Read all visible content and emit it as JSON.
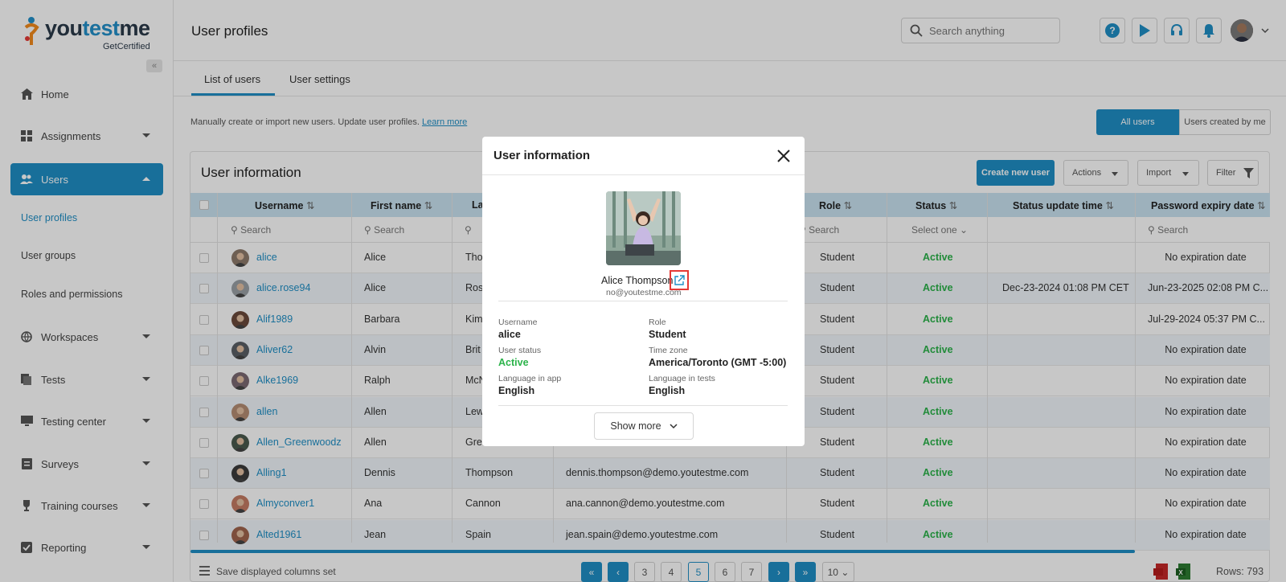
{
  "app": {
    "logo_text_a": "you",
    "logo_text_b": "test",
    "logo_text_c": "me",
    "logo_sub": "GetCertified"
  },
  "sidebar": {
    "items": [
      {
        "label": "Home",
        "icon": "home-icon"
      },
      {
        "label": "Assignments",
        "icon": "assignments-icon"
      },
      {
        "label": "Users",
        "icon": "users-icon"
      },
      {
        "label": "Workspaces",
        "icon": "globe-icon"
      },
      {
        "label": "Tests",
        "icon": "tests-icon"
      },
      {
        "label": "Testing center",
        "icon": "monitor-icon"
      },
      {
        "label": "Surveys",
        "icon": "surveys-icon"
      },
      {
        "label": "Training courses",
        "icon": "trophy-icon"
      },
      {
        "label": "Reporting",
        "icon": "reporting-icon"
      }
    ],
    "sub_items": [
      "User profiles",
      "User groups",
      "Roles and permissions"
    ]
  },
  "header": {
    "title": "User profiles",
    "search_placeholder": "Search anything"
  },
  "tabs": [
    "List of users",
    "User settings"
  ],
  "info": {
    "text": "Manually create or import new users. Update user profiles.",
    "link": "Learn more"
  },
  "segments": [
    "All users",
    "Users created by me"
  ],
  "card": {
    "title": "User information",
    "create_label": "Create new user",
    "actions_label": "Actions",
    "import_label": "Import",
    "filter_label": "Filter"
  },
  "table": {
    "headers": [
      "Username",
      "First name",
      "La",
      "Role",
      "Status",
      "Status update time",
      "Password expiry date"
    ],
    "search": "Search",
    "select_one": "Select one",
    "rows": [
      {
        "username": "alice",
        "first": "Alice",
        "last": "Tho",
        "email": "",
        "role": "Student",
        "status": "Active",
        "update": "",
        "expiry": "No expiration date"
      },
      {
        "username": "alice.rose94",
        "first": "Alice",
        "last": "Ros",
        "email": "",
        "role": "Student",
        "status": "Active",
        "update": "Dec-23-2024 01:08 PM CET",
        "expiry": "Jun-23-2025 02:08 PM C..."
      },
      {
        "username": "Alif1989",
        "first": "Barbara",
        "last": "Kim",
        "email": "",
        "role": "Student",
        "status": "Active",
        "update": "",
        "expiry": "Jul-29-2024 05:37 PM C..."
      },
      {
        "username": "Aliver62",
        "first": "Alvin",
        "last": "Brit",
        "email": "",
        "role": "Student",
        "status": "Active",
        "update": "",
        "expiry": "No expiration date"
      },
      {
        "username": "Alke1969",
        "first": "Ralph",
        "last": "McN",
        "email": "",
        "role": "Student",
        "status": "Active",
        "update": "",
        "expiry": "No expiration date"
      },
      {
        "username": "allen",
        "first": "Allen",
        "last": "Lew",
        "email": "",
        "role": "Student",
        "status": "Active",
        "update": "",
        "expiry": "No expiration date"
      },
      {
        "username": "Allen_Greenwoodz",
        "first": "Allen",
        "last": "Gre",
        "email": "",
        "role": "Student",
        "status": "Active",
        "update": "",
        "expiry": "No expiration date"
      },
      {
        "username": "Alling1",
        "first": "Dennis",
        "last": "Thompson",
        "email": "dennis.thompson@demo.youtestme.com",
        "role": "Student",
        "status": "Active",
        "update": "",
        "expiry": "No expiration date"
      },
      {
        "username": "Almyconver1",
        "first": "Ana",
        "last": "Cannon",
        "email": "ana.cannon@demo.youtestme.com",
        "role": "Student",
        "status": "Active",
        "update": "",
        "expiry": "No expiration date"
      },
      {
        "username": "Alted1961",
        "first": "Jean",
        "last": "Spain",
        "email": "jean.spain@demo.youtestme.com",
        "role": "Student",
        "status": "Active",
        "update": "",
        "expiry": "No expiration date"
      }
    ]
  },
  "footer": {
    "save_columns": "Save displayed columns set",
    "pages": [
      "3",
      "4",
      "5",
      "6",
      "7"
    ],
    "current_page": "5",
    "page_size": "10",
    "rows_label": "Rows: 793"
  },
  "modal": {
    "title": "User information",
    "name": "Alice Thompson",
    "email": "no@youtestme.com",
    "fields": [
      {
        "label": "Username",
        "value": "alice"
      },
      {
        "label": "Role",
        "value": "Student"
      },
      {
        "label": "User status",
        "value": "Active"
      },
      {
        "label": "Time zone",
        "value": "America/Toronto (GMT -5:00)"
      },
      {
        "label": "Language in app",
        "value": "English"
      },
      {
        "label": "Language in tests",
        "value": "English"
      }
    ],
    "show_more": "Show more"
  },
  "colors": {
    "accent": "#1f8fc6",
    "active": "#2bb34a",
    "highlight": "#e53935"
  }
}
